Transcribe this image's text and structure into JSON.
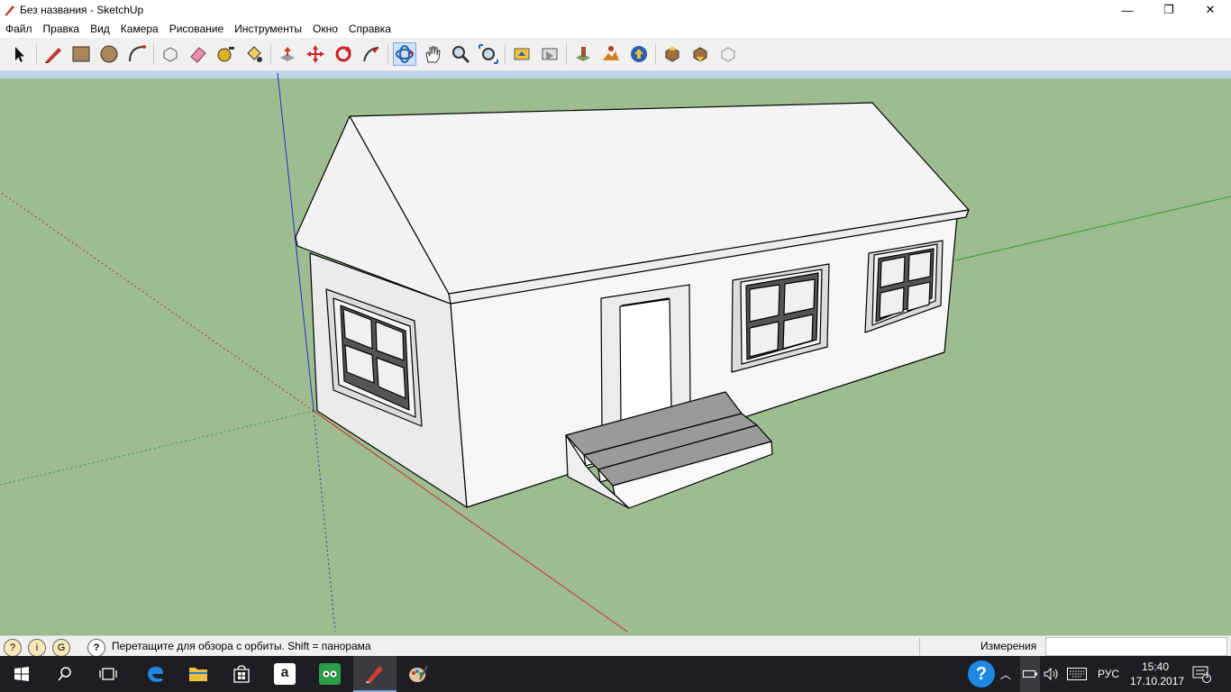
{
  "window": {
    "title": "Без названия - SketchUp",
    "minimize": "—",
    "maximize": "❐",
    "close": "✕"
  },
  "menu": [
    "Файл",
    "Правка",
    "Вид",
    "Камера",
    "Рисование",
    "Инструменты",
    "Окно",
    "Справка"
  ],
  "toolbar": {
    "tools": [
      "select-icon",
      "pencil-icon",
      "rectangle-icon",
      "circle-icon",
      "arc-icon",
      "make-component-icon",
      "eraser-icon",
      "tape-measure-icon",
      "paint-bucket-icon",
      "push-pull-icon",
      "move-icon",
      "rotate-icon",
      "follow-me-icon",
      "orbit-icon",
      "pan-icon",
      "zoom-icon",
      "zoom-extents-icon",
      "previous-view-icon",
      "next-view-icon",
      "add-location-icon",
      "toggle-terrain-icon",
      "get-models-icon",
      "share-model-icon",
      "get-photo-texture-icon",
      "share-component-icon",
      "extension-warehouse-icon"
    ]
  },
  "status": {
    "hint": "Перетащите для обзора с орбиты.  Shift = панорама",
    "measurements_label": "Измерения",
    "measurements_value": ""
  },
  "taskbar": {
    "apps": [
      "windows-start-icon",
      "search-icon",
      "task-view-icon",
      "edge-icon",
      "file-explorer-icon",
      "store-icon",
      "amazon-icon",
      "tripadvisor-icon",
      "sketchup-icon",
      "paint-icon"
    ],
    "tray": {
      "help": "?",
      "language": "РУС",
      "time": "15:40",
      "date": "17.10.2017",
      "notification_count": "1"
    }
  },
  "colors": {
    "ground": "#9dbd91",
    "sky": "#bcd3e8",
    "house_face": "#f4f4f4",
    "house_shadow_face": "#e6e6e6",
    "axis_red": "#cc2a2a",
    "axis_green": "#2aa02a",
    "axis_blue": "#2a2acc"
  }
}
